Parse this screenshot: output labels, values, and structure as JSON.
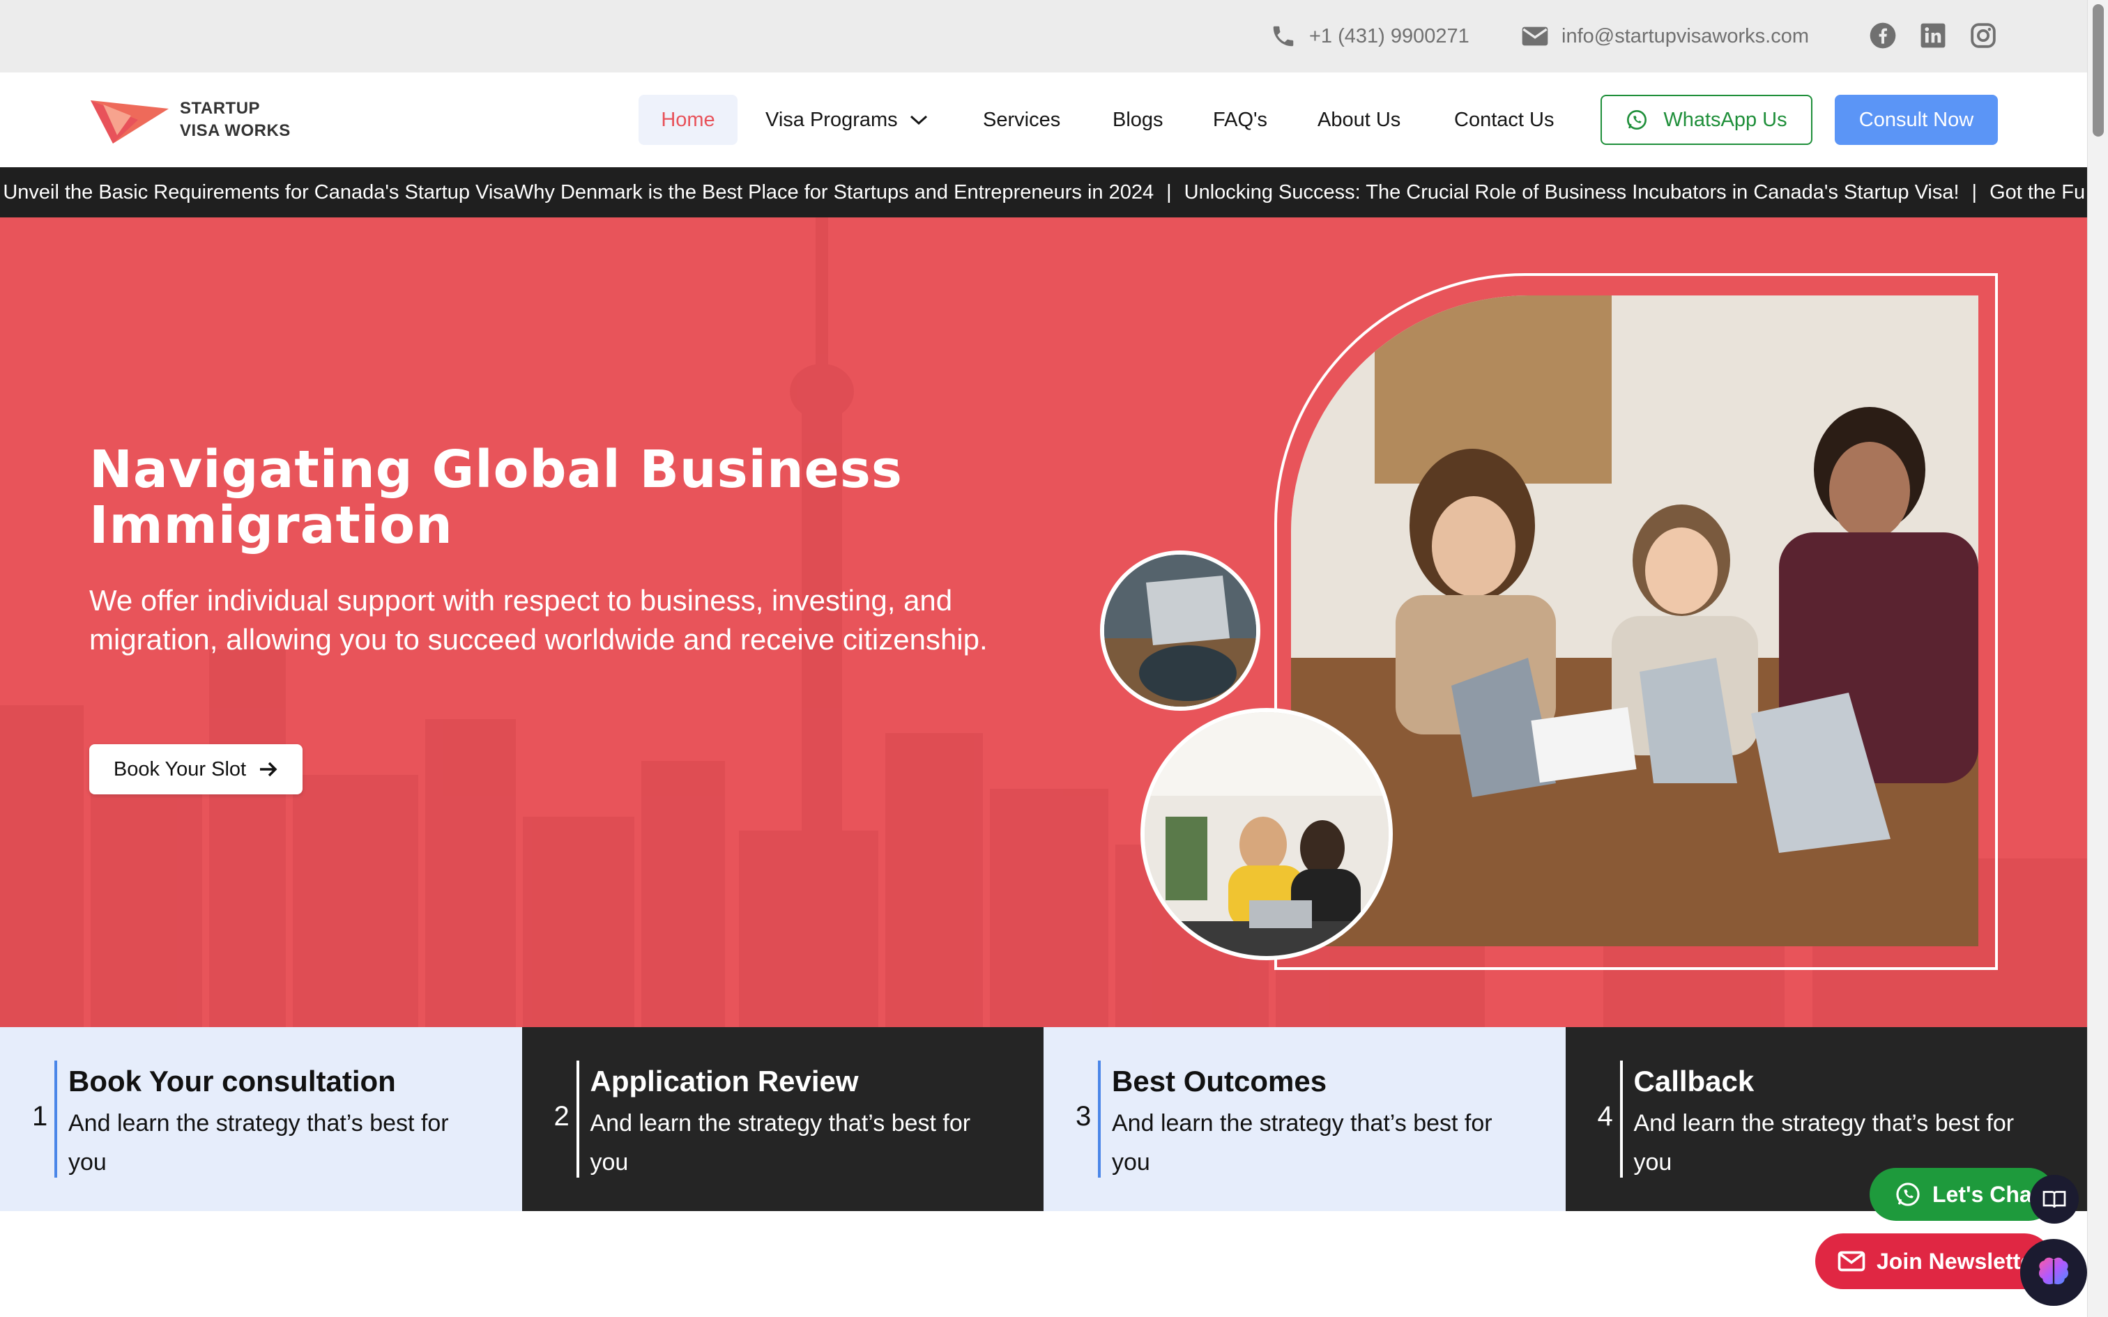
{
  "topbar": {
    "phone": "+1 (431) 9900271",
    "email": "info@startupvisaworks.com",
    "social": [
      "facebook-icon",
      "linkedin-icon",
      "instagram-icon"
    ]
  },
  "brand": {
    "line1": "STARTUP",
    "line2": "VISA WORKS",
    "accent": "#e8525a"
  },
  "nav": {
    "home": "Home",
    "visa_programs": "Visa Programs",
    "services": "Services",
    "blogs": "Blogs",
    "faq": "FAQ's",
    "about": "About Us",
    "contact": "Contact Us",
    "whatsapp": "WhatsApp Us",
    "consult": "Consult Now"
  },
  "ticker": {
    "items": [
      "d? Unveil the Basic Requirements for Canada's Startup VisaWhy Denmark is the Best Place for Startups and Entrepreneurs in 2024",
      "Unlocking Success: The Crucial Role of Business Incubators in Canada's Startup Visa!",
      "Got the Fu"
    ],
    "separator": "|"
  },
  "hero": {
    "title": "Navigating Global Business Immigration",
    "subtitle": "We offer individual support with respect to business, investing, and migration, allowing you to succeed worldwide and receive citizenship.",
    "cta": "Book Your Slot",
    "background": "#e8545a"
  },
  "steps": [
    {
      "num": "1",
      "title": "Book Your consultation",
      "desc": "And learn the strategy that’s best for you",
      "theme": "light"
    },
    {
      "num": "2",
      "title": "Application Review",
      "desc": "And learn the strategy that’s best for you",
      "theme": "dark"
    },
    {
      "num": "3",
      "title": "Best Outcomes",
      "desc": "And learn the strategy that’s best for you",
      "theme": "light"
    },
    {
      "num": "4",
      "title": "Callback",
      "desc": "And learn the strategy that’s best for you",
      "theme": "dark"
    }
  ],
  "widgets": {
    "chat": "Let's Chat",
    "newsletter": "Join Newsletter"
  }
}
